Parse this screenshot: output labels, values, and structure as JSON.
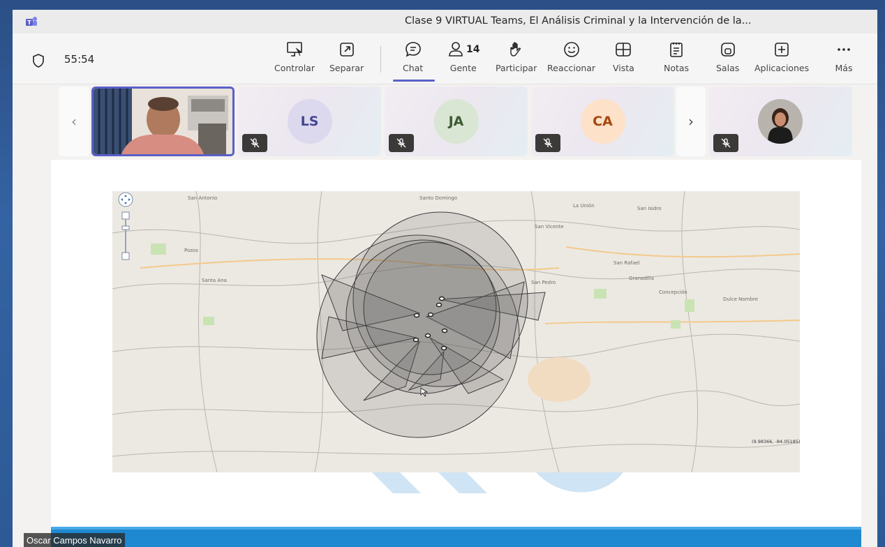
{
  "window": {
    "title": "Clase 9 VIRTUAL Teams, El Análisis Criminal y la Intervención de la..."
  },
  "meeting": {
    "timer": "55:54",
    "people_count": "14"
  },
  "toolbar": {
    "controlar": "Controlar",
    "separar": "Separar",
    "chat": "Chat",
    "gente": "Gente",
    "participar": "Participar",
    "reaccionar": "Reaccionar",
    "vista": "Vista",
    "notas": "Notas",
    "salas": "Salas",
    "aplicaciones": "Aplicaciones",
    "mas": "Más"
  },
  "participants": [
    {
      "initials": "LS",
      "bg": "#dcd9ee",
      "fg": "#444791"
    },
    {
      "initials": "JA",
      "bg": "#d9e6d3",
      "fg": "#3c5a33"
    },
    {
      "initials": "CA",
      "bg": "#fde1c9",
      "fg": "#a5480e"
    }
  ],
  "map": {
    "labels": [
      "Santo Domingo",
      "San Vicente",
      "San Pedro",
      "San Rafael",
      "Granadilla",
      "Concepción",
      "Dulce Nombre",
      "Santa Ana",
      "Pozos",
      "San Antonio",
      "La Unión",
      "San Isidro"
    ],
    "coordinates": "(9.98366, -84.05185)"
  },
  "presenter": {
    "name": "Oscar Campos Navarro"
  },
  "colors": {
    "accent": "#5b5fc7",
    "footer_bar": "#1e88d0"
  }
}
